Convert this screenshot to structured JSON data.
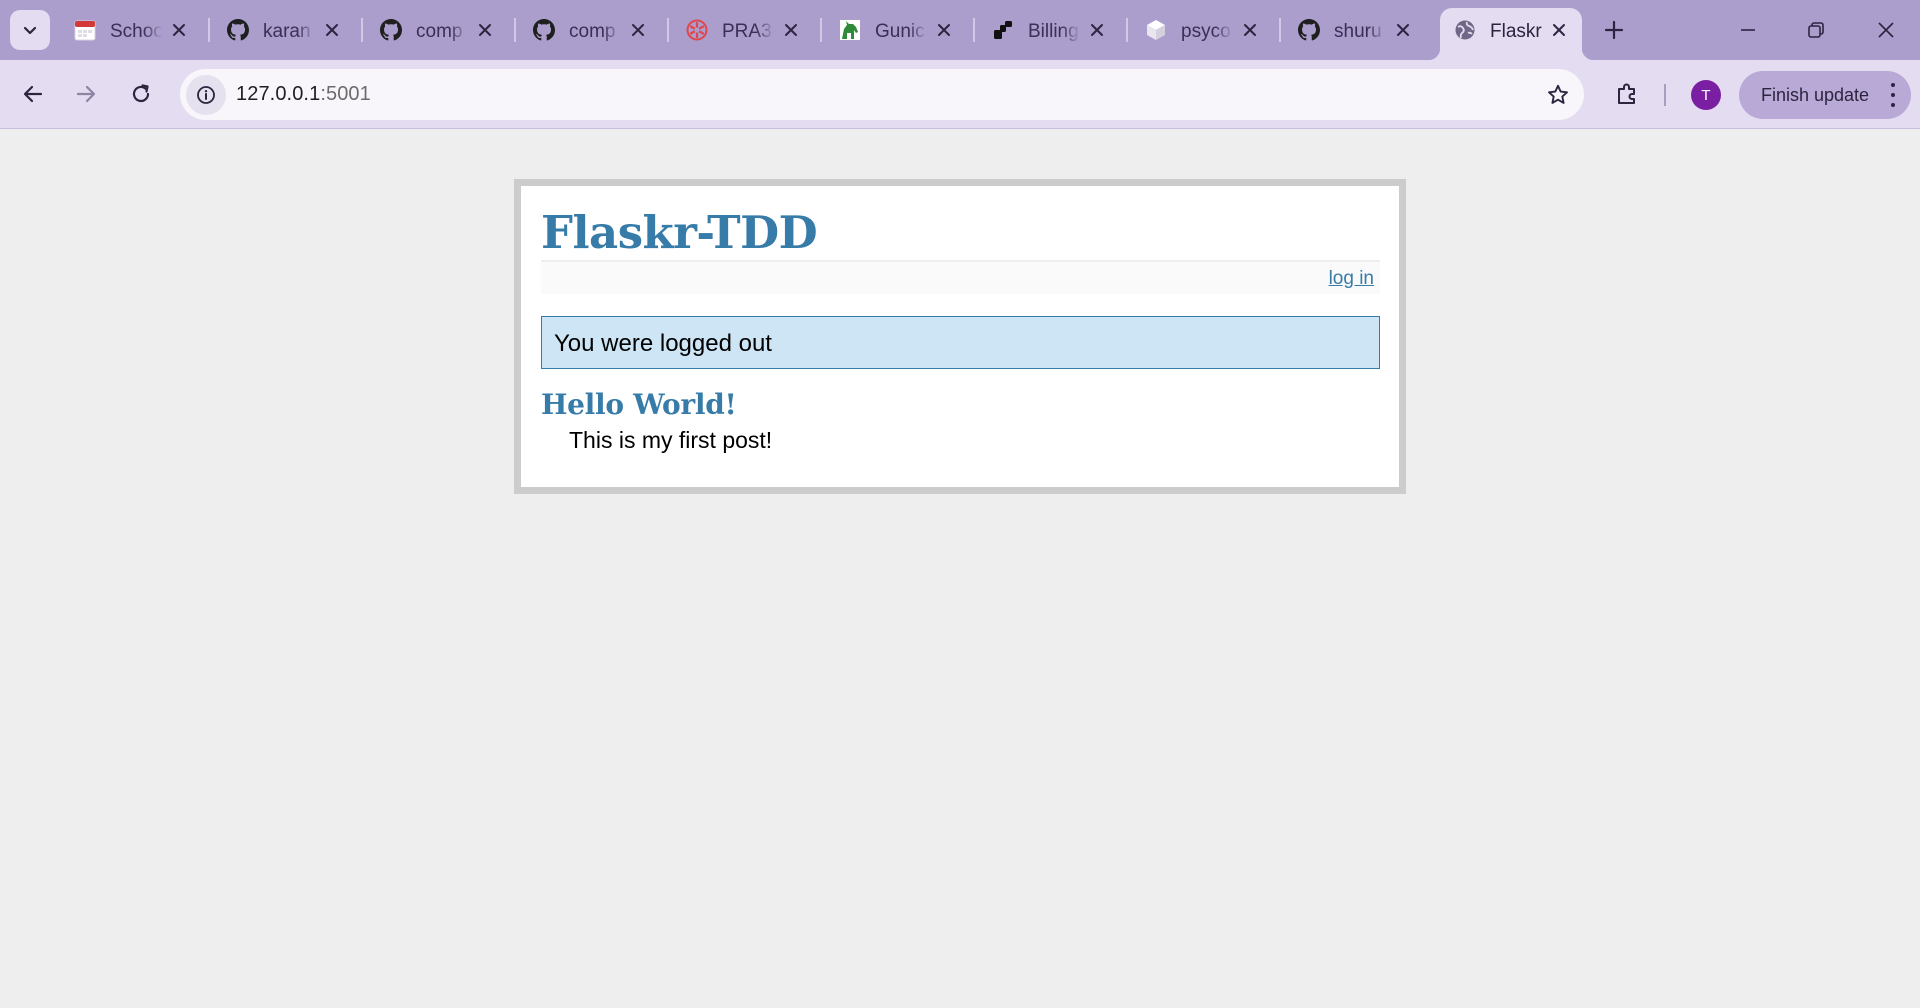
{
  "browser": {
    "tabs": [
      {
        "title": "School",
        "icon": "calendar-icon"
      },
      {
        "title": "karan",
        "icon": "github-icon"
      },
      {
        "title": "comp",
        "icon": "github-icon"
      },
      {
        "title": "comp",
        "icon": "github-icon"
      },
      {
        "title": "PRA3",
        "icon": "asterisk-icon"
      },
      {
        "title": "Gunic",
        "icon": "unicorn-icon"
      },
      {
        "title": "Billing",
        "icon": "brand-icon"
      },
      {
        "title": "psyco",
        "icon": "cube-icon"
      },
      {
        "title": "shuru",
        "icon": "github-icon"
      },
      {
        "title": "Flaskr",
        "icon": "globe-icon",
        "active": true
      }
    ],
    "address": {
      "host": "127.0.0.1",
      "port": ":5001"
    },
    "profile_initial": "T",
    "update_label": "Finish update",
    "colors": {
      "frame": "#ab9dcc",
      "toolbar": "#e4dcf1",
      "avatar": "#7b1fa2"
    }
  },
  "page": {
    "title": "Flaskr-TDD",
    "nav": {
      "login_label": "log in"
    },
    "flash": "You were logged out",
    "entries": [
      {
        "title": "Hello World!",
        "text": "This is my first post!"
      }
    ],
    "colors": {
      "accent": "#377ba8",
      "flash_bg": "#cee5f5",
      "page_bg": "#eeeeee",
      "box_border": "#cccccc"
    }
  }
}
